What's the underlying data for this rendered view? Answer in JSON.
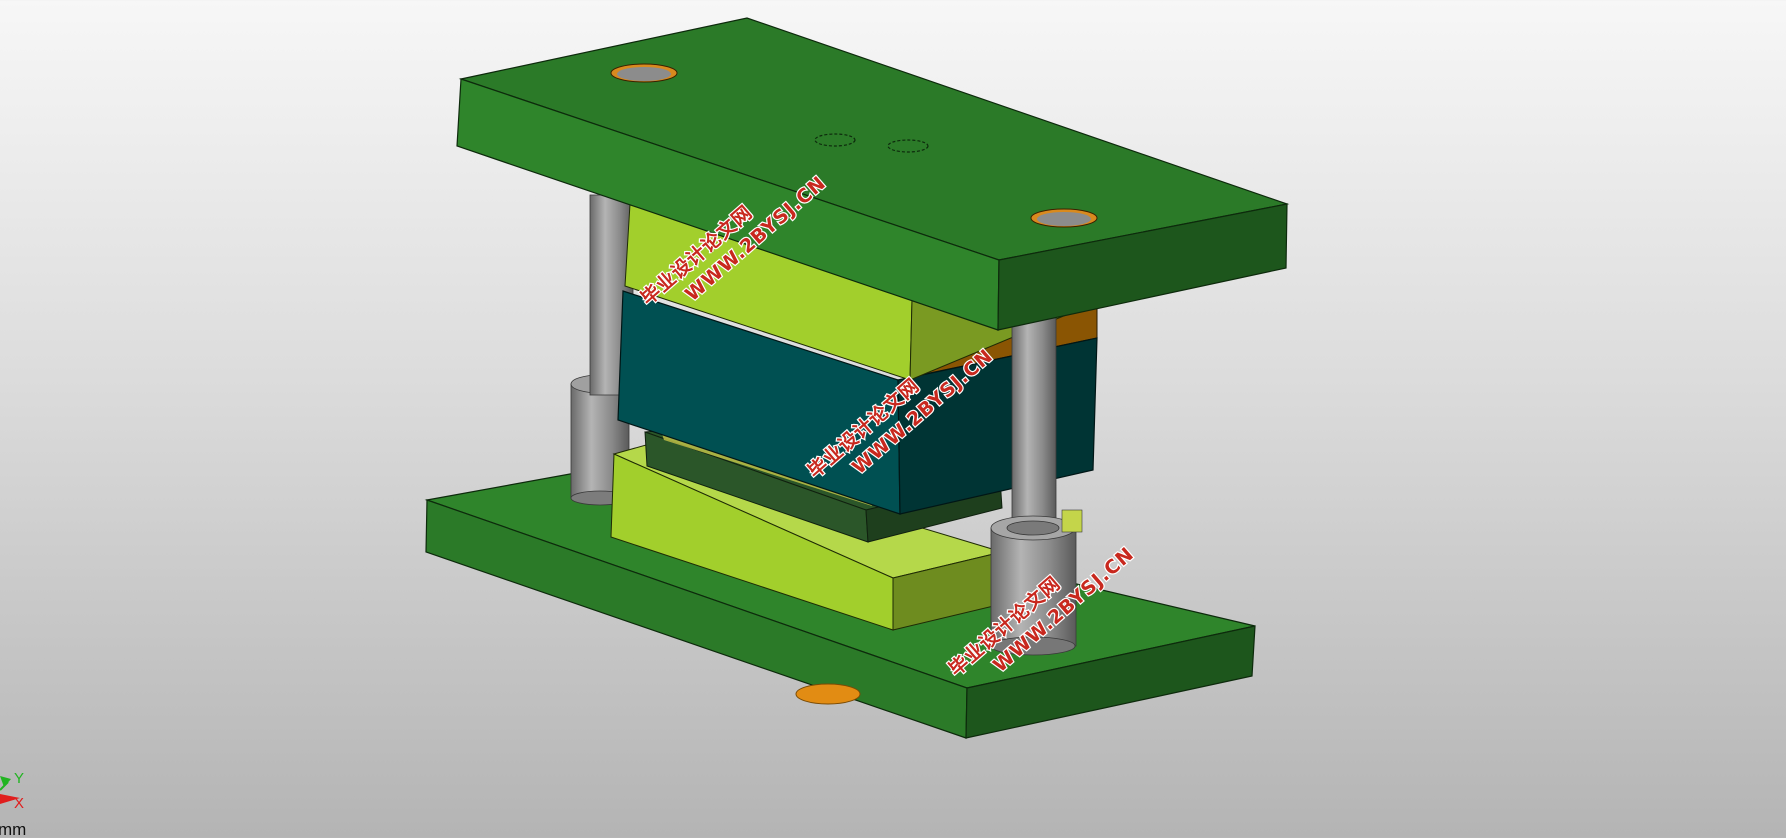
{
  "viewport": {
    "units_label": "mm",
    "background": {
      "top": "#f7f7f7",
      "bottom": "#b4b4b4"
    }
  },
  "triad": {
    "y_label": "Y",
    "x_label": "X",
    "y_color": "#22b422",
    "x_color": "#e01e1e"
  },
  "watermarks": [
    {
      "line1": "毕业设计论文网",
      "line2": "WWW.2BYSJ.CN"
    },
    {
      "line1": "毕业设计论文网",
      "line2": "WWW.2BYSJ.CN"
    },
    {
      "line1": "毕业设计论文网",
      "line2": "WWW.2BYSJ.CN"
    }
  ],
  "model": {
    "name": "die-set-assembly",
    "colors": {
      "die_shoe_green": "#2b7a28",
      "die_shoe_green_dark": "#1d561c",
      "die_shoe_green_light": "#2f852b",
      "plate_yellow_green": "#a2cf2c",
      "plate_yellow_green_side": "#6e8c1f",
      "punch_plate_teal": "#005052",
      "punch_plate_teal_dark": "#003434",
      "stripper_dark_green": "#2b5629",
      "orange_block": "#8a5503",
      "guide_post_grey": "#8d8d8d",
      "bushing_ring_orange": "#d98a1e"
    }
  }
}
